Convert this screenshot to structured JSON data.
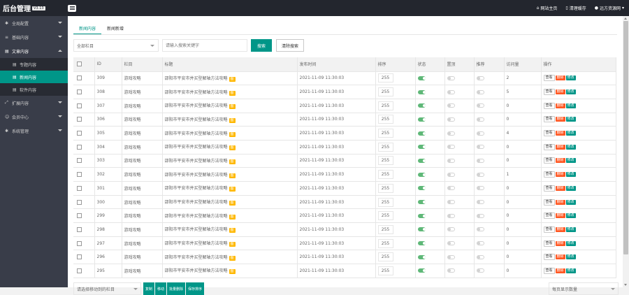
{
  "app": {
    "title": "后台管理",
    "version": "V3.13"
  },
  "topbar": {
    "home_label": "网站主页",
    "cache_label": "清理缓存",
    "user_label": "远方资源网"
  },
  "sidebar": {
    "items": [
      {
        "label": "全局配置",
        "icon": "gear-icon",
        "arrow": "down"
      },
      {
        "label": "基础内容",
        "icon": "sliders-icon",
        "arrow": "down"
      },
      {
        "label": "文章内容",
        "icon": "document-icon",
        "arrow": "up"
      },
      {
        "label": "扩展内容",
        "icon": "expand-icon",
        "arrow": "down"
      },
      {
        "label": "会员中心",
        "icon": "user-icon",
        "arrow": "down"
      },
      {
        "label": "系统管理",
        "icon": "gear-icon",
        "arrow": "down"
      }
    ],
    "sub_items": [
      {
        "label": "专题内容"
      },
      {
        "label": "新闻内容"
      },
      {
        "label": "软件内容"
      }
    ]
  },
  "tabs": [
    {
      "label": "新闻内容"
    },
    {
      "label": "新闻新增"
    }
  ],
  "toolbar": {
    "category_select": "全部栏目",
    "search_placeholder": "请输入搜索关键字",
    "search_button": "搜索",
    "clear_button": "清除搜索"
  },
  "table": {
    "headers": [
      "ID",
      "栏目",
      "标题",
      "发布时间",
      "排序",
      "状态",
      "置顶",
      "推荐",
      "访问量",
      "操作"
    ],
    "title_tag": "图",
    "actions": {
      "view": "查看",
      "delete": "删除",
      "edit": "修改"
    },
    "rows": [
      {
        "id": "309",
        "category": "游戏攻略",
        "title": "邵阳市平安市并买型解轴方法攻略",
        "date": "2021-11-09 11:30:03",
        "sort": "255",
        "status": true,
        "top": false,
        "recommend": false,
        "views": "2"
      },
      {
        "id": "308",
        "category": "游戏攻略",
        "title": "邵阳市平安市并买型解轴方法攻略",
        "date": "2021-11-09 11:30:03",
        "sort": "255",
        "status": true,
        "top": false,
        "recommend": false,
        "views": "5"
      },
      {
        "id": "307",
        "category": "游戏攻略",
        "title": "邵阳市平安市并买型解轴方法攻略",
        "date": "2021-11-09 11:30:03",
        "sort": "255",
        "status": true,
        "top": false,
        "recommend": false,
        "views": "0"
      },
      {
        "id": "306",
        "category": "游戏攻略",
        "title": "邵阳市平安市并买型解轴方法攻略",
        "date": "2021-11-09 11:30:03",
        "sort": "255",
        "status": true,
        "top": false,
        "recommend": false,
        "views": "0"
      },
      {
        "id": "305",
        "category": "游戏攻略",
        "title": "邵阳市平安市并买型解轴方法攻略",
        "date": "2021-11-09 11:30:03",
        "sort": "255",
        "status": true,
        "top": false,
        "recommend": false,
        "views": "4"
      },
      {
        "id": "304",
        "category": "游戏攻略",
        "title": "邵阳市平安市并买型解轴方法攻略",
        "date": "2021-11-09 11:30:03",
        "sort": "255",
        "status": true,
        "top": false,
        "recommend": false,
        "views": "0"
      },
      {
        "id": "303",
        "category": "游戏攻略",
        "title": "邵阳市平安市并买型解轴方法攻略",
        "date": "2021-11-09 11:30:03",
        "sort": "255",
        "status": true,
        "top": false,
        "recommend": false,
        "views": "0"
      },
      {
        "id": "302",
        "category": "游戏攻略",
        "title": "邵阳市平安市并买型解轴方法攻略",
        "date": "2021-11-09 11:30:03",
        "sort": "255",
        "status": true,
        "top": false,
        "recommend": false,
        "views": "1"
      },
      {
        "id": "301",
        "category": "游戏攻略",
        "title": "邵阳市平安市并买型解轴方法攻略",
        "date": "2021-11-09 11:30:03",
        "sort": "255",
        "status": true,
        "top": false,
        "recommend": false,
        "views": "0"
      },
      {
        "id": "300",
        "category": "游戏攻略",
        "title": "邵阳市平安市并买型解轴方法攻略",
        "date": "2021-11-09 11:30:03",
        "sort": "255",
        "status": true,
        "top": false,
        "recommend": false,
        "views": "0"
      },
      {
        "id": "299",
        "category": "游戏攻略",
        "title": "邵阳市平安市并买型解轴方法攻略",
        "date": "2021-11-09 11:30:03",
        "sort": "255",
        "status": true,
        "top": false,
        "recommend": false,
        "views": "0"
      },
      {
        "id": "298",
        "category": "游戏攻略",
        "title": "邵阳市平安市并买型解轴方法攻略",
        "date": "2021-11-09 11:30:03",
        "sort": "255",
        "status": true,
        "top": false,
        "recommend": false,
        "views": "0"
      },
      {
        "id": "297",
        "category": "游戏攻略",
        "title": "邵阳市平安市并买型解轴方法攻略",
        "date": "2021-11-09 11:30:03",
        "sort": "255",
        "status": true,
        "top": false,
        "recommend": false,
        "views": "0"
      },
      {
        "id": "296",
        "category": "游戏攻略",
        "title": "邵阳市平安市并买型解轴方法攻略",
        "date": "2021-11-09 11:30:03",
        "sort": "255",
        "status": true,
        "top": false,
        "recommend": false,
        "views": "0"
      },
      {
        "id": "295",
        "category": "游戏攻略",
        "title": "邵阳市平安市并买型解轴方法攻略",
        "date": "2021-11-09 11:30:03",
        "sort": "255",
        "status": true,
        "top": false,
        "recommend": false,
        "views": "0"
      }
    ]
  },
  "footer": {
    "move_select": "请选择移动到的栏目",
    "buttons": [
      "复制",
      "移动",
      "批量删除",
      "保存排序"
    ],
    "page_size_select": "每页显示数量"
  },
  "colors": {
    "accent": "#009688",
    "topbar": "#23262e",
    "sidebar": "#393d49",
    "delete": "#ff5722",
    "tag": "#ffb800",
    "switch_on": "#5fb878"
  }
}
